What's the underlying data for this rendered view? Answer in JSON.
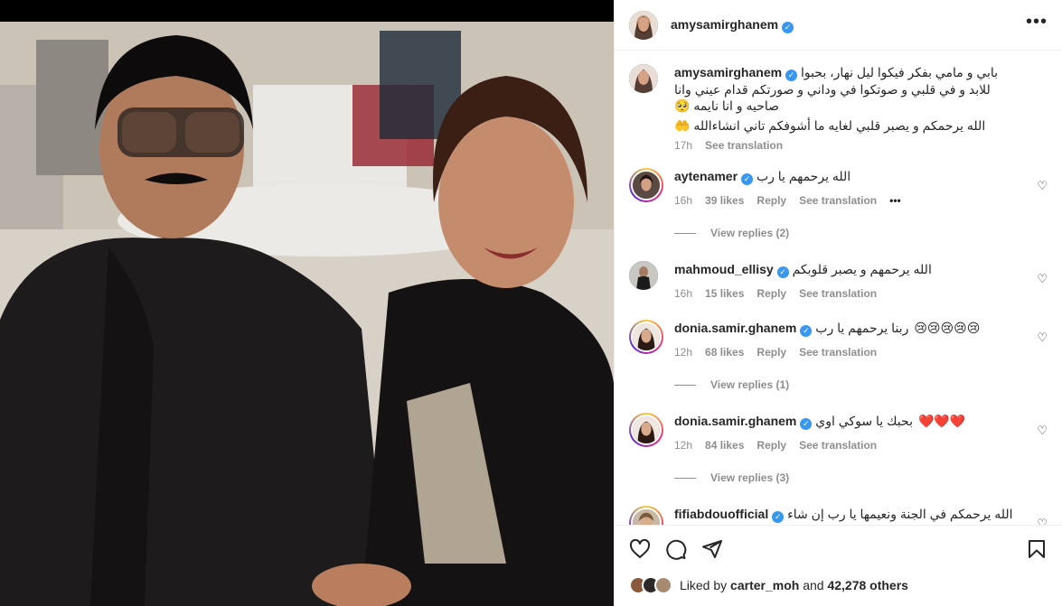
{
  "post": {
    "author": "amysamirghanem",
    "verified_mark": "✓"
  },
  "caption": {
    "username": "amysamirghanem",
    "text": "بابي و مامي بفكر فيكوا ليل نهار، بحبوا للابد و في قلبي و صوتكوا في وداني و صورتكم قدام عيني وانا صاحيه و انا نايمه 🥺",
    "text2": "الله يرحمكم و يصبر قلبي لغايه ما أشوفكم تاني انشاءالله 🤲",
    "time": "17h",
    "see_translation": "See translation"
  },
  "comments": [
    {
      "username": "aytenamer",
      "text": "الله يرحمهم يا رب",
      "time": "16h",
      "likes": "39 likes",
      "reply": "Reply",
      "see_translation": "See translation",
      "more": "•••",
      "view_replies": "View replies (2)"
    },
    {
      "username": "mahmoud_ellisy",
      "text": "الله يرحمهم و يصبر قلوبكم",
      "time": "16h",
      "likes": "15 likes",
      "reply": "Reply",
      "see_translation": "See translation"
    },
    {
      "username": "donia.samir.ghanem",
      "text": "ربنا يرحمهم يا رب",
      "emojis": "😢😢😢😢😢",
      "time": "12h",
      "likes": "68 likes",
      "reply": "Reply",
      "see_translation": "See translation",
      "view_replies": "View replies (1)"
    },
    {
      "username": "donia.samir.ghanem",
      "text": "بحبك يا سوكي اوي",
      "emojis": "❤️❤️❤️",
      "time": "12h",
      "likes": "84 likes",
      "reply": "Reply",
      "see_translation": "See translation",
      "view_replies": "View replies (3)"
    },
    {
      "username": "fifiabdouofficial",
      "text": "الله يرحمكم في الجنة ونعيمها يا رب إن شاء الله"
    }
  ],
  "likes": {
    "prefix": "Liked by",
    "user": "carter_moh",
    "and": "and",
    "count": "42,278 others"
  },
  "icons": {
    "like": "heart-icon",
    "comment": "comment-icon",
    "share": "paper-plane-icon",
    "save": "bookmark-icon",
    "more": "more-horizontal-icon"
  },
  "colors": {
    "verified": "#3897f0",
    "secondary_text": "#8e8e8e",
    "primary_text": "#262626",
    "heart_emoji": "#e0245e"
  }
}
